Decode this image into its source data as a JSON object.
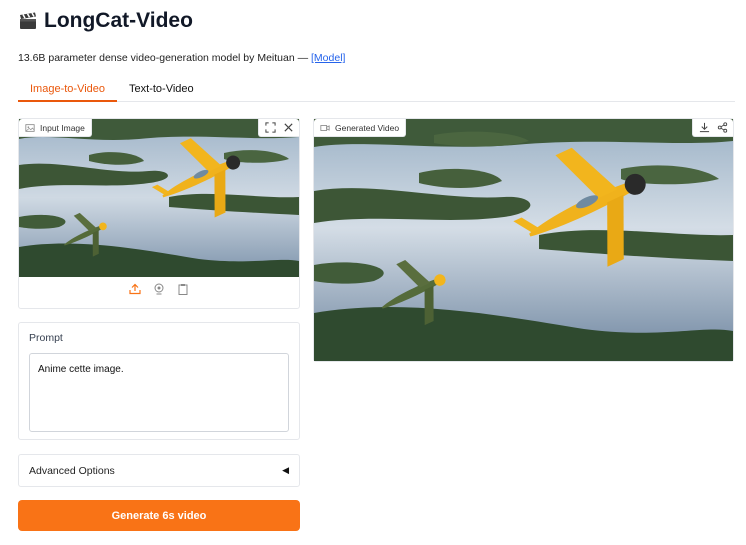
{
  "app": {
    "title": "LongCat-Video",
    "title_icon": "clapper-board-icon",
    "subtitle_text": "13.6B parameter dense video-generation model by Meituan — ",
    "subtitle_link": "[Model]"
  },
  "tabs": [
    {
      "label": "Image-to-Video",
      "active": true
    },
    {
      "label": "Text-to-Video",
      "active": false
    }
  ],
  "input_image": {
    "label": "Input Image",
    "icons": [
      "image-icon",
      "fullscreen-icon",
      "close-icon",
      "upload-icon",
      "webcam-icon",
      "clipboard-icon"
    ]
  },
  "output_video": {
    "label": "Generated Video",
    "icons": [
      "video-icon",
      "download-icon",
      "share-icon"
    ]
  },
  "prompt": {
    "label": "Prompt",
    "value": "Anime cette image."
  },
  "advanced": {
    "label": "Advanced Options",
    "caret": "◀"
  },
  "generate_button": {
    "label": "Generate 6s video"
  },
  "colors": {
    "accent": "#f97316",
    "tab_active": "#ea580c",
    "link": "#2563eb"
  }
}
